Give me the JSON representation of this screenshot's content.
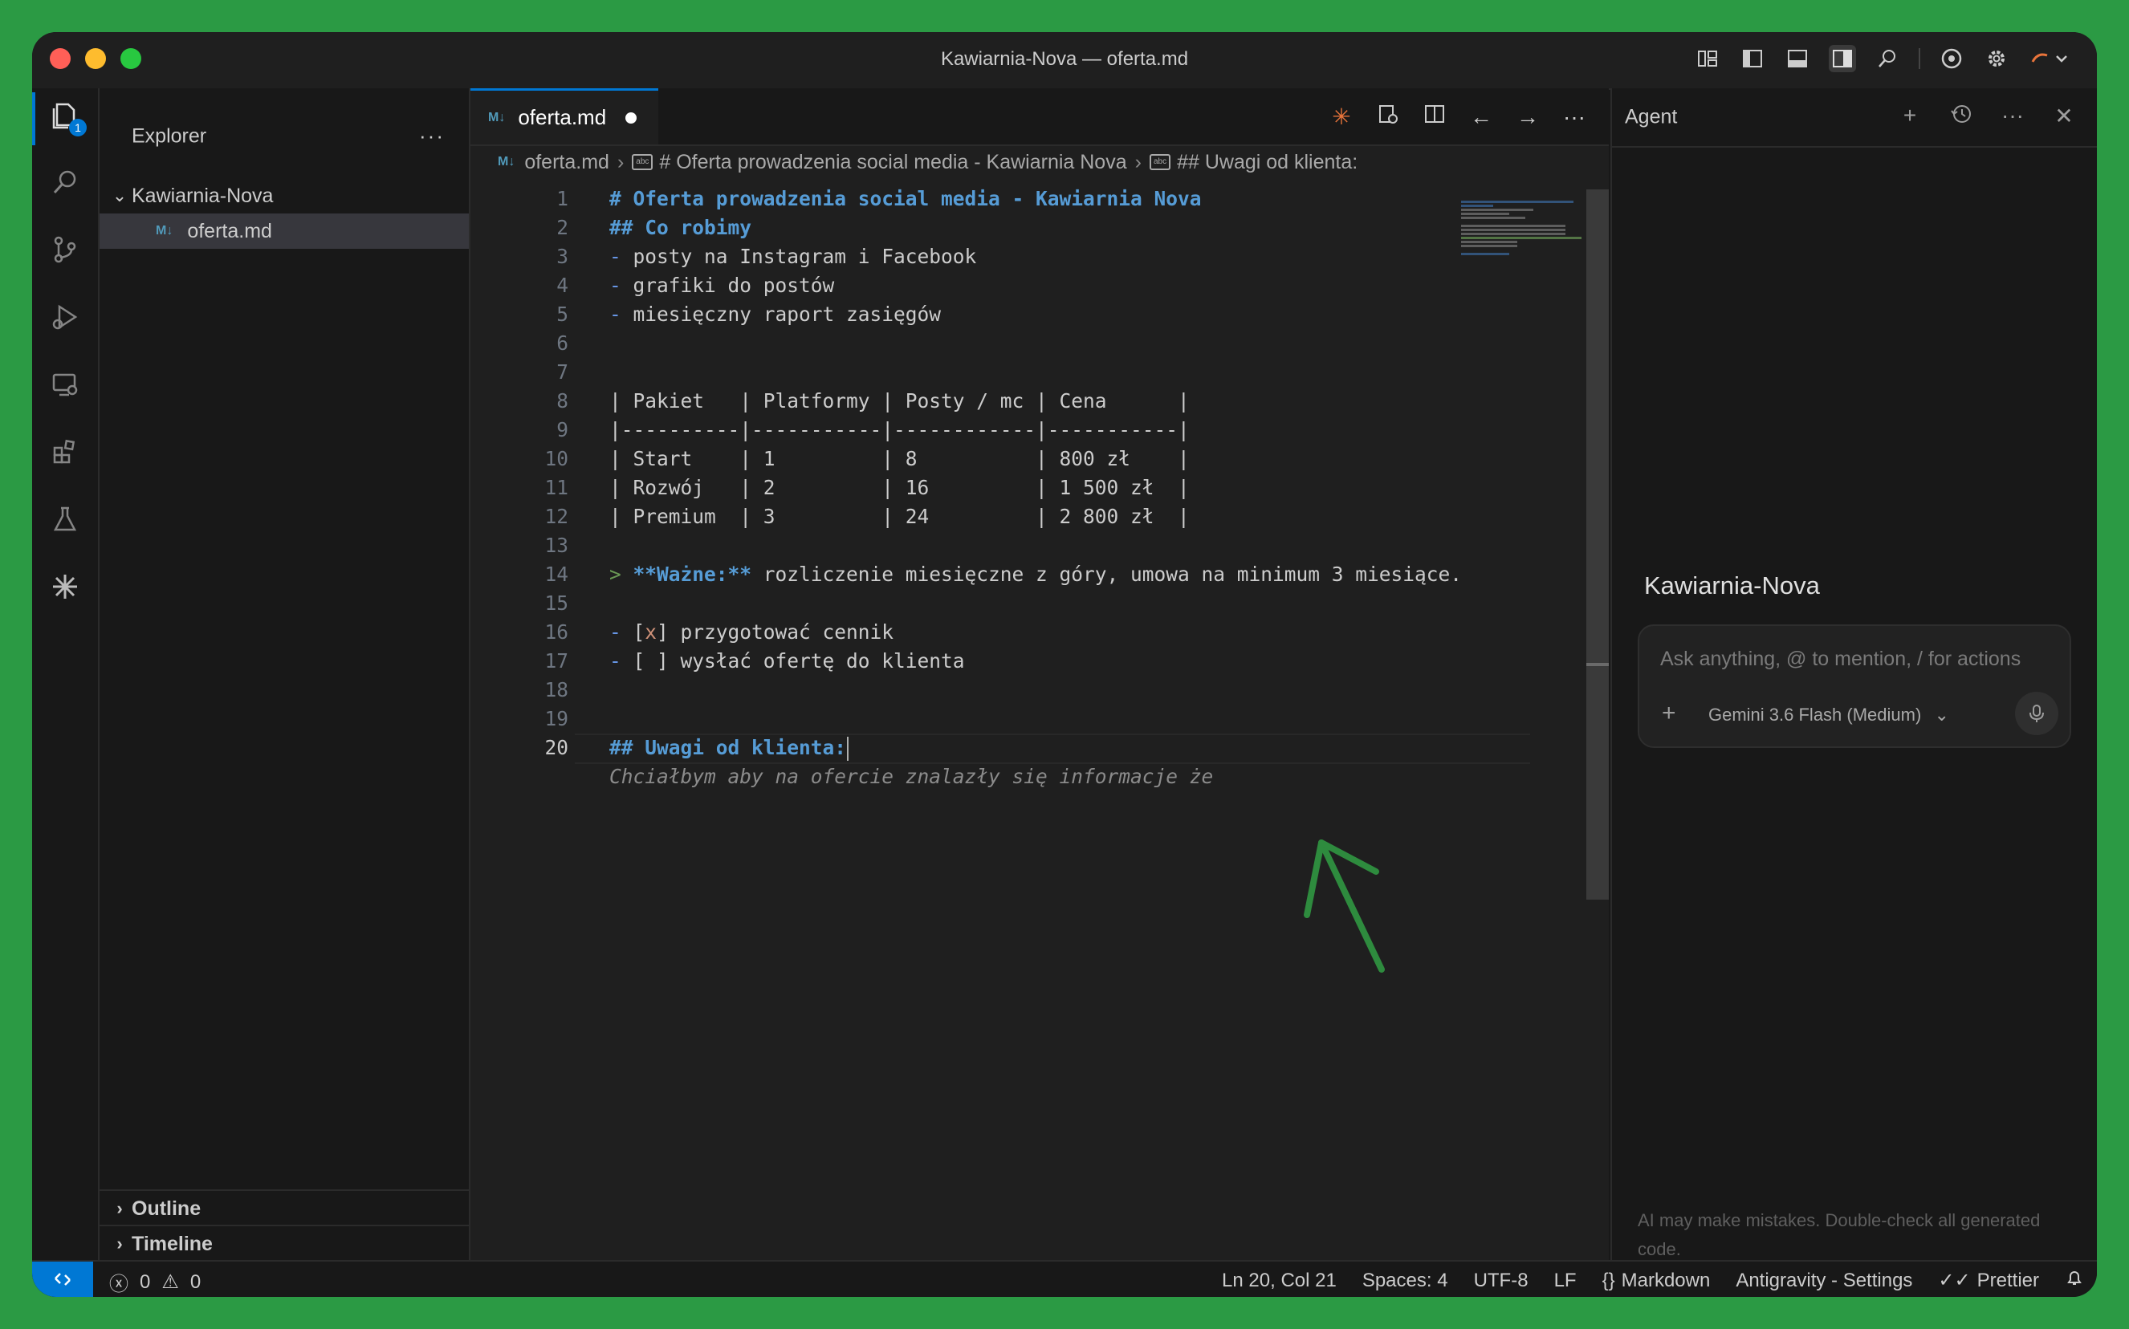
{
  "window": {
    "title": "Kawiarnia-Nova — oferta.md"
  },
  "activity_bar": {
    "explorer_badge": "1"
  },
  "sidebar": {
    "title": "Explorer",
    "more": "···",
    "folder": "Kawiarnia-Nova",
    "file_badge": "M↓",
    "file": "oferta.md",
    "outline": "Outline",
    "timeline": "Timeline"
  },
  "editor": {
    "tab_label": "oferta.md",
    "tab_badge": "M↓",
    "breadcrumb": {
      "file": "oferta.md",
      "symbol1": "# Oferta prowadzenia social media - Kawiarnia Nova",
      "symbol2": "## Uwagi od klienta:"
    },
    "lines": [
      {
        "n": "1",
        "parts": [
          {
            "t": "# Oferta prowadzenia social media - Kawiarnia Nova",
            "c": "h"
          }
        ]
      },
      {
        "n": "2",
        "parts": [
          {
            "t": "## Co robimy",
            "c": "h"
          }
        ]
      },
      {
        "n": "3",
        "parts": [
          {
            "t": "-",
            "c": "li"
          },
          {
            "t": " posty na Instagram i Facebook",
            "c": ""
          }
        ]
      },
      {
        "n": "4",
        "parts": [
          {
            "t": "-",
            "c": "li"
          },
          {
            "t": " grafiki do postów",
            "c": ""
          }
        ]
      },
      {
        "n": "5",
        "parts": [
          {
            "t": "-",
            "c": "li"
          },
          {
            "t": " miesięczny raport zasięgów",
            "c": ""
          }
        ]
      },
      {
        "n": "6",
        "parts": []
      },
      {
        "n": "7",
        "parts": []
      },
      {
        "n": "8",
        "parts": [
          {
            "t": "| Pakiet   | Platformy | Posty / mc | Cena      |",
            "c": ""
          }
        ]
      },
      {
        "n": "9",
        "parts": [
          {
            "t": "|----------|-----------|------------|-----------|",
            "c": ""
          }
        ]
      },
      {
        "n": "10",
        "parts": [
          {
            "t": "| Start    | 1         | 8          | 800 zł    |",
            "c": ""
          }
        ]
      },
      {
        "n": "11",
        "parts": [
          {
            "t": "| Rozwój   | 2         | 16         | 1 500 zł  |",
            "c": ""
          }
        ]
      },
      {
        "n": "12",
        "parts": [
          {
            "t": "| Premium  | 3         | 24         | 2 800 zł  |",
            "c": ""
          }
        ]
      },
      {
        "n": "13",
        "parts": []
      },
      {
        "n": "14",
        "parts": [
          {
            "t": ">",
            "c": "q"
          },
          {
            "t": " **Ważne:**",
            "c": "bold"
          },
          {
            "t": " rozliczenie miesięczne z góry, umowa na minimum 3 miesiące.",
            "c": ""
          }
        ]
      },
      {
        "n": "15",
        "parts": []
      },
      {
        "n": "16",
        "parts": [
          {
            "t": "-",
            "c": "li"
          },
          {
            "t": " [",
            "c": ""
          },
          {
            "t": "x",
            "c": "x"
          },
          {
            "t": "] przygotować cennik",
            "c": ""
          }
        ]
      },
      {
        "n": "17",
        "parts": [
          {
            "t": "-",
            "c": "li"
          },
          {
            "t": " [ ] wysłać ofertę do klienta",
            "c": ""
          }
        ]
      },
      {
        "n": "18",
        "parts": []
      },
      {
        "n": "19",
        "parts": []
      },
      {
        "n": "20",
        "parts": [
          {
            "t": "## Uwagi od klienta:",
            "c": "h"
          }
        ],
        "current": true
      }
    ],
    "ghost_text": "Chciałbym aby na ofercie znalazły się informacje że"
  },
  "agent": {
    "title": "Agent",
    "workspace": "Kawiarnia-Nova",
    "input_placeholder": "Ask anything, @ to mention, / for actions",
    "model": "Gemini 3.6 Flash (Medium)",
    "disclaimer": "AI may make mistakes. Double-check all generated code."
  },
  "status": {
    "errors": "0",
    "warnings": "0",
    "position": "Ln 20, Col 21",
    "spaces": "Spaces: 4",
    "encoding": "UTF-8",
    "eol": "LF",
    "language": "Markdown",
    "settings": "Antigravity - Settings",
    "formatter": "Prettier"
  },
  "colors": {
    "background": "#2b9a44",
    "accent": "#0078d4",
    "heading": "#569cd6",
    "annotation_arrow": "#2e8b3e"
  }
}
